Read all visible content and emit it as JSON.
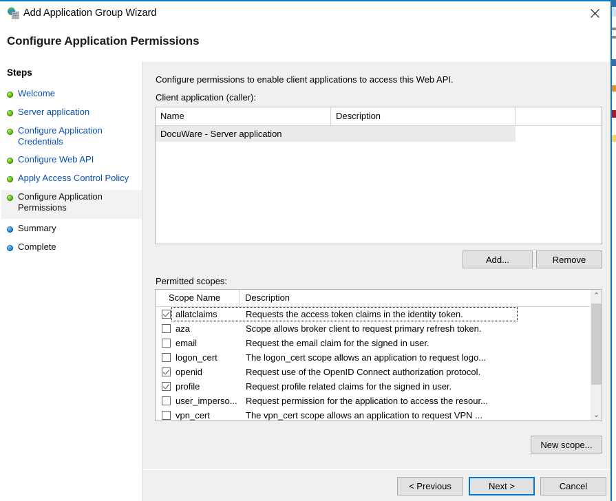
{
  "window": {
    "title": "Add Application Group Wizard",
    "icon": "adfs-application-group-icon",
    "close_label": "✕",
    "accent_color": "#0b7ac7"
  },
  "page": {
    "title": "Configure Application Permissions",
    "intro": "Configure permissions to enable client applications to access this Web API."
  },
  "sidebar": {
    "heading": "Steps",
    "items": [
      {
        "label": "Welcome",
        "state": "done",
        "link": true
      },
      {
        "label": "Server application",
        "state": "done",
        "link": true
      },
      {
        "label": "Configure Application Credentials",
        "state": "done",
        "link": true
      },
      {
        "label": "Configure Web API",
        "state": "done",
        "link": true
      },
      {
        "label": "Apply Access Control Policy",
        "state": "done",
        "link": true
      },
      {
        "label": "Configure Application Permissions",
        "state": "done",
        "link": false,
        "current": true
      },
      {
        "label": "Summary",
        "state": "pending",
        "link": false
      },
      {
        "label": "Complete",
        "state": "pending",
        "link": false
      }
    ]
  },
  "client_application": {
    "label": "Client application (caller):",
    "columns": [
      "Name",
      "Description"
    ],
    "rows": [
      {
        "name": "DocuWare - Server application",
        "description": "",
        "selected": true
      }
    ],
    "add_button": "Add...",
    "remove_button": "Remove"
  },
  "permitted_scopes": {
    "label": "Permitted scopes:",
    "columns": [
      "Scope Name",
      "Description"
    ],
    "rows": [
      {
        "checked": true,
        "focused": true,
        "name": "allatclaims",
        "description": "Requests the access token claims in the identity token."
      },
      {
        "checked": false,
        "focused": false,
        "name": "aza",
        "description": "Scope allows broker client to request primary refresh token."
      },
      {
        "checked": false,
        "focused": false,
        "name": "email",
        "description": "Request the email claim for the signed in user."
      },
      {
        "checked": false,
        "focused": false,
        "name": "logon_cert",
        "description": "The logon_cert scope allows an application to request logo..."
      },
      {
        "checked": true,
        "focused": false,
        "name": "openid",
        "description": "Request use of the OpenID Connect authorization protocol."
      },
      {
        "checked": true,
        "focused": false,
        "name": "profile",
        "description": "Request profile related claims for the signed in user."
      },
      {
        "checked": false,
        "focused": false,
        "name": "user_imperso...",
        "description": "Request permission for the application to access the resour..."
      },
      {
        "checked": false,
        "focused": false,
        "name": "vpn_cert",
        "description": "The vpn_cert scope allows an application to request VPN ..."
      }
    ],
    "new_scope_button": "New scope...",
    "scroll_up_glyph": "⌃",
    "scroll_down_glyph": "⌄"
  },
  "footer": {
    "previous_button": "< Previous",
    "next_button": "Next >",
    "cancel_button": "Cancel",
    "focused_button": "Next >"
  }
}
